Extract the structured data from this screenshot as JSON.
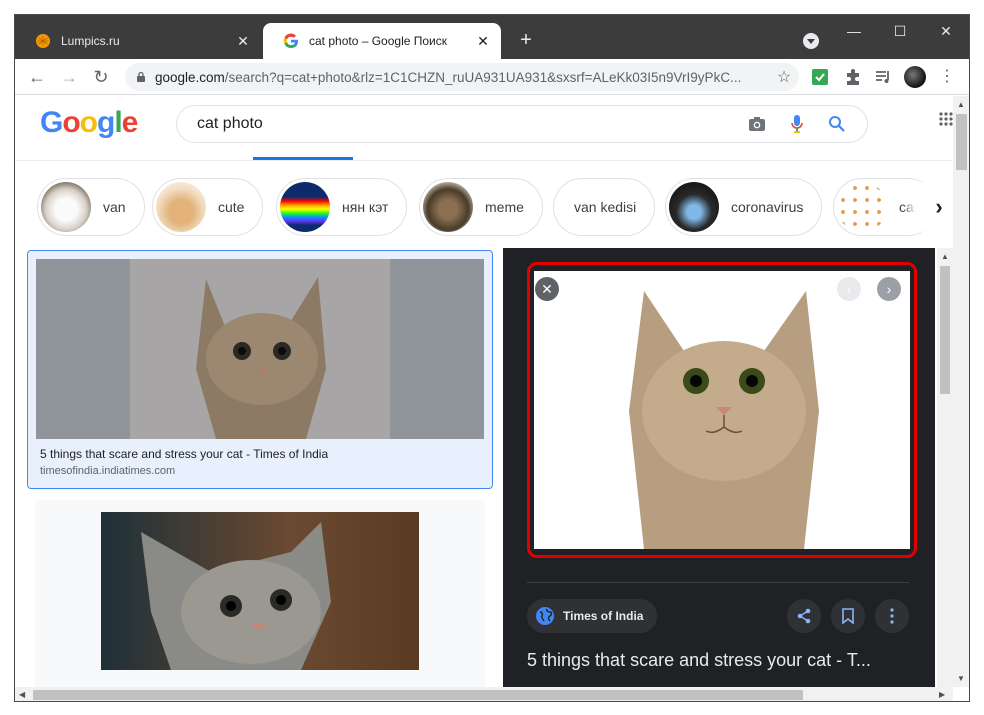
{
  "browser": {
    "tabs": [
      {
        "title": "Lumpics.ru",
        "icon": "orange-circle-favicon"
      },
      {
        "title": "cat photo – Google Поиск",
        "icon": "google-favicon"
      }
    ],
    "url_host": "google.com",
    "url_rest": "/search?q=cat+photo&rlz=1C1CHZN_ruUA931UA931&sxsrf=ALeKk03I5n9VrI9yPkC..."
  },
  "search": {
    "query": "cat photo"
  },
  "related_chips": [
    {
      "label": "van"
    },
    {
      "label": "cute"
    },
    {
      "label": "нян кэт"
    },
    {
      "label": "meme"
    },
    {
      "label": "van kedisi"
    },
    {
      "label": "coronavirus"
    },
    {
      "label": "car"
    }
  ],
  "results": [
    {
      "caption": "5 things that scare and stress your cat - Times of India",
      "site": "timesofindia.indiatimes.com"
    }
  ],
  "preview": {
    "source": "Times of India",
    "title": "5 things that scare and stress your cat - T..."
  },
  "colors": {
    "highlight_border": "#e00000",
    "selected_border": "#4285f4",
    "panel_bg": "#202124"
  }
}
